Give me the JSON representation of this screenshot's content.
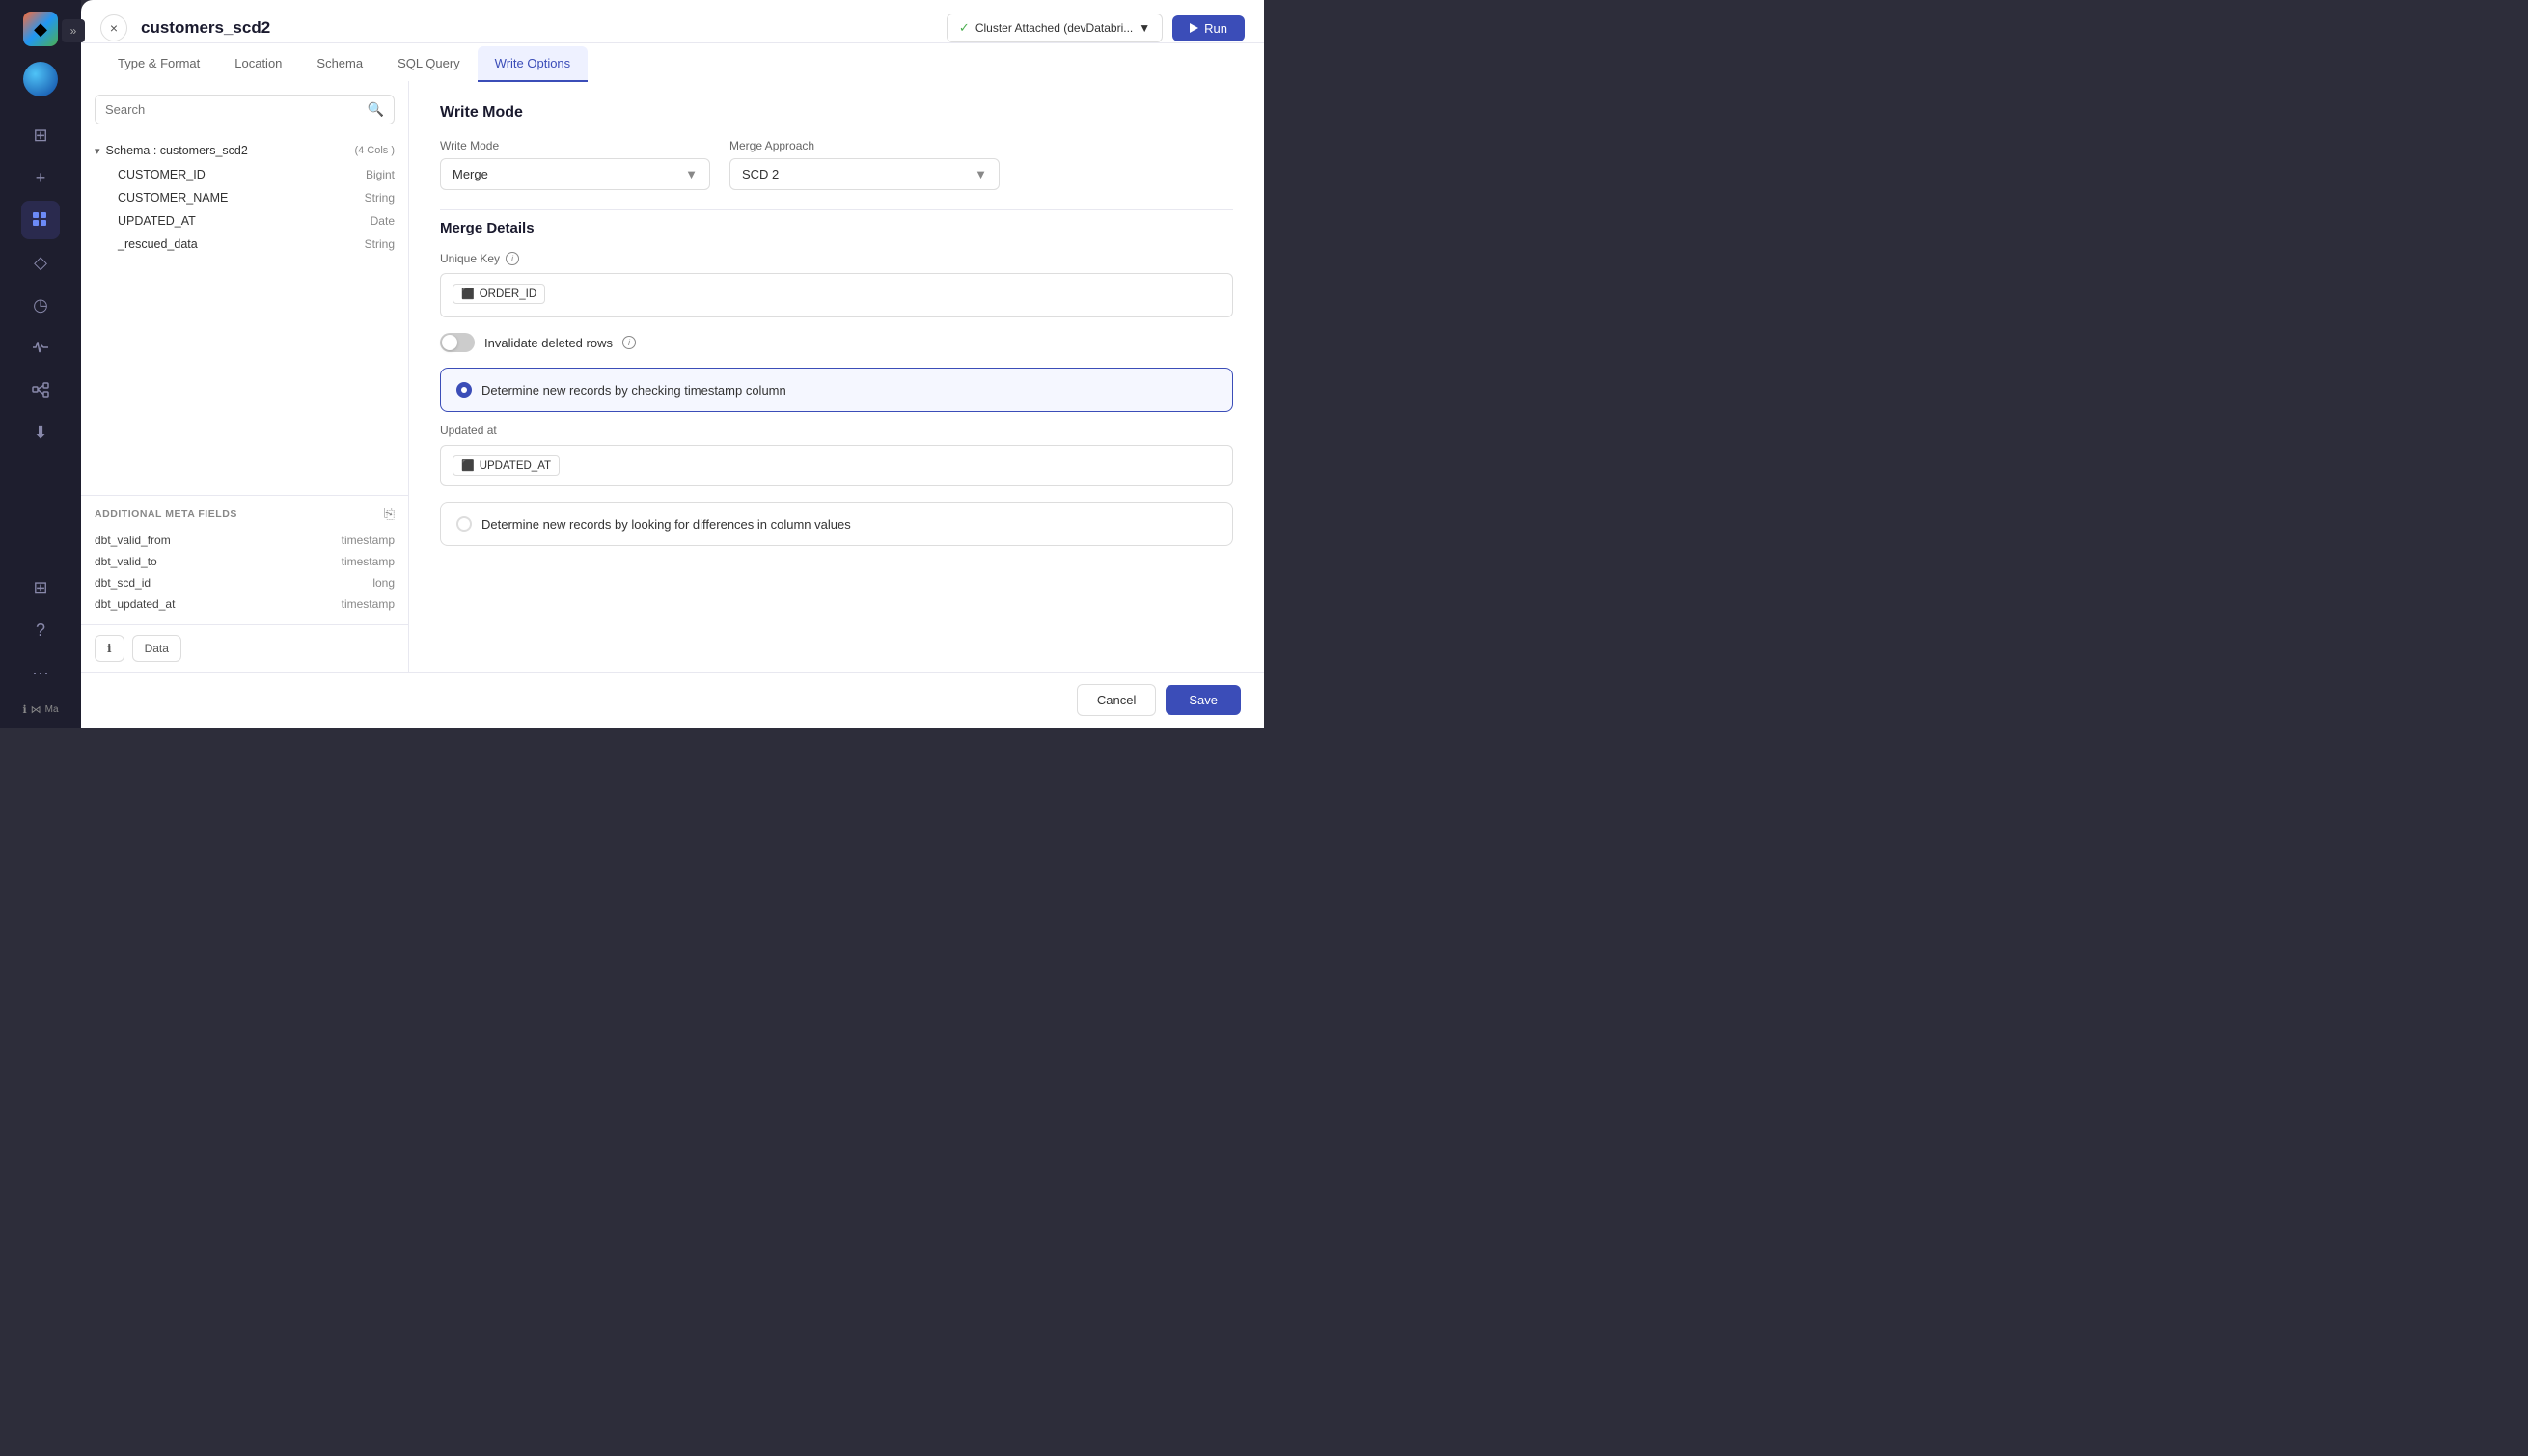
{
  "app": {
    "title": "customers_scd2"
  },
  "header": {
    "close_label": "×",
    "cluster_text": "Cluster Attached (devDatabri...",
    "cluster_check": "✓",
    "run_label": "Run"
  },
  "tabs": [
    {
      "id": "type-format",
      "label": "Type & Format"
    },
    {
      "id": "location",
      "label": "Location"
    },
    {
      "id": "schema",
      "label": "Schema"
    },
    {
      "id": "sql-query",
      "label": "SQL Query"
    },
    {
      "id": "write-options",
      "label": "Write Options"
    }
  ],
  "left_panel": {
    "search": {
      "placeholder": "Search",
      "value": ""
    },
    "schema": {
      "name": "Schema : customers_scd2",
      "cols_count": "(4 Cols )",
      "columns": [
        {
          "name": "CUSTOMER_ID",
          "type": "Bigint"
        },
        {
          "name": "CUSTOMER_NAME",
          "type": "String"
        },
        {
          "name": "UPDATED_AT",
          "type": "Date"
        },
        {
          "name": "_rescued_data",
          "type": "String"
        }
      ]
    },
    "additional_meta": {
      "title": "ADDITIONAL META FIELDS",
      "fields": [
        {
          "name": "dbt_valid_from",
          "type": "timestamp"
        },
        {
          "name": "dbt_valid_to",
          "type": "timestamp"
        },
        {
          "name": "dbt_scd_id",
          "type": "long"
        },
        {
          "name": "dbt_updated_at",
          "type": "timestamp"
        }
      ]
    },
    "footer": {
      "info_btn": "ℹ",
      "data_btn": "Data"
    }
  },
  "right_panel": {
    "write_mode_title": "Write Mode",
    "write_mode_label": "Write Mode",
    "write_mode_value": "Merge",
    "merge_approach_label": "Merge Approach",
    "merge_approach_value": "SCD 2",
    "merge_details_title": "Merge Details",
    "unique_key_label": "Unique Key",
    "unique_key_tag": "ORDER_ID",
    "invalidate_label": "Invalidate deleted rows",
    "timestamp_option": {
      "label": "Determine new records by checking timestamp column",
      "selected": true
    },
    "column_values_option": {
      "label": "Determine new records by looking for differences in column values",
      "selected": false
    },
    "updated_at_label": "Updated at",
    "updated_at_tag": "UPDATED_AT"
  },
  "footer": {
    "cancel_label": "Cancel",
    "save_label": "Save"
  },
  "sidebar": {
    "icons": [
      {
        "id": "logo",
        "symbol": "◆"
      },
      {
        "id": "photo",
        "symbol": "⊞"
      },
      {
        "id": "plus",
        "symbol": "+"
      },
      {
        "id": "grid",
        "symbol": "⋮⋮"
      },
      {
        "id": "diamond",
        "symbol": "◇"
      },
      {
        "id": "clock",
        "symbol": "◷"
      },
      {
        "id": "pulse",
        "symbol": "∿"
      },
      {
        "id": "schema",
        "symbol": "⬡"
      },
      {
        "id": "download",
        "symbol": "⬇"
      },
      {
        "id": "table",
        "symbol": "⊞"
      },
      {
        "id": "question",
        "symbol": "?"
      },
      {
        "id": "more",
        "symbol": "···"
      },
      {
        "id": "info",
        "symbol": "ℹ"
      },
      {
        "id": "meta",
        "symbol": "⋈"
      }
    ]
  },
  "colors": {
    "accent": "#3b4db8",
    "active_tab_bg": "#eef1ff",
    "selected_radio_border": "#3b4db8",
    "green_check": "#4caf50"
  }
}
